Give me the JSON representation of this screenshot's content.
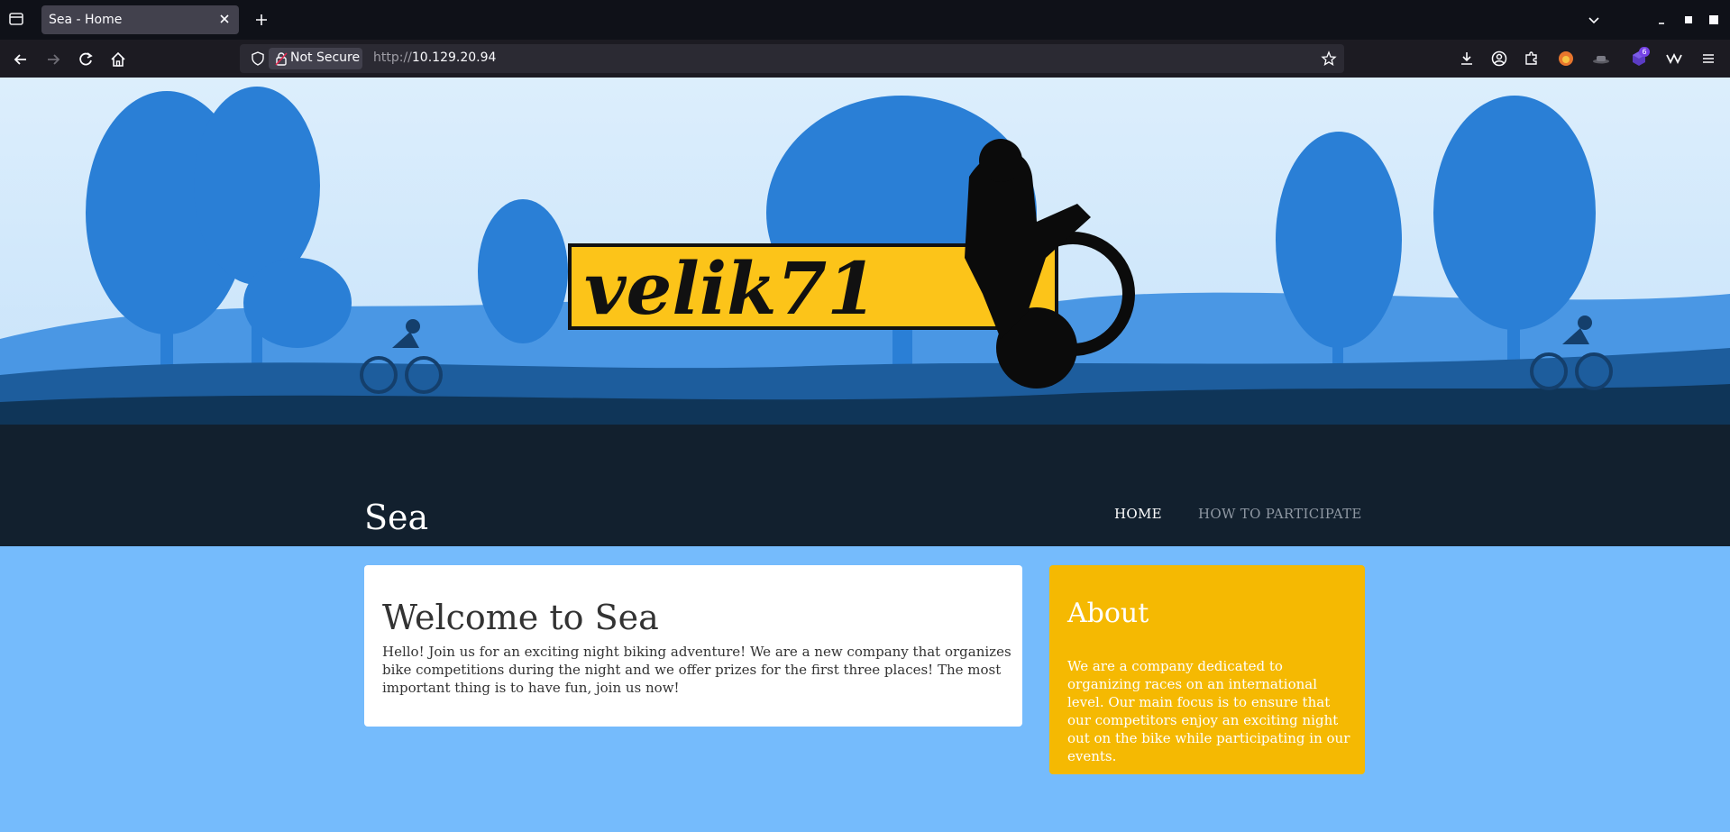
{
  "browser": {
    "tab_title": "Sea - Home",
    "security_label": "Not Secure",
    "url_protocol": "http://",
    "url_host": "10.129.20.94",
    "extension_badge_count": "6"
  },
  "site": {
    "logo_text": "velik71",
    "title": "Sea",
    "nav": {
      "home": "HOME",
      "participate": "HOW TO PARTICIPATE"
    }
  },
  "welcome": {
    "heading": "Welcome to Sea",
    "body": "Hello! Join us for an exciting night biking adventure! We are a new company that organizes bike competitions during the night and we offer prizes for the first three places! The most important thing is to have fun, join us now!"
  },
  "about": {
    "heading": "About",
    "body": "We are a company dedicated to organizing races on an international level. Our main focus is to ensure that our competitors enjoy an exciting night out on the bike while participating in our events."
  },
  "colors": {
    "page_bg": "#75bbfc",
    "header_dark": "#12202e",
    "about_card": "#f5b902",
    "logo_yellow": "#fcc419"
  }
}
